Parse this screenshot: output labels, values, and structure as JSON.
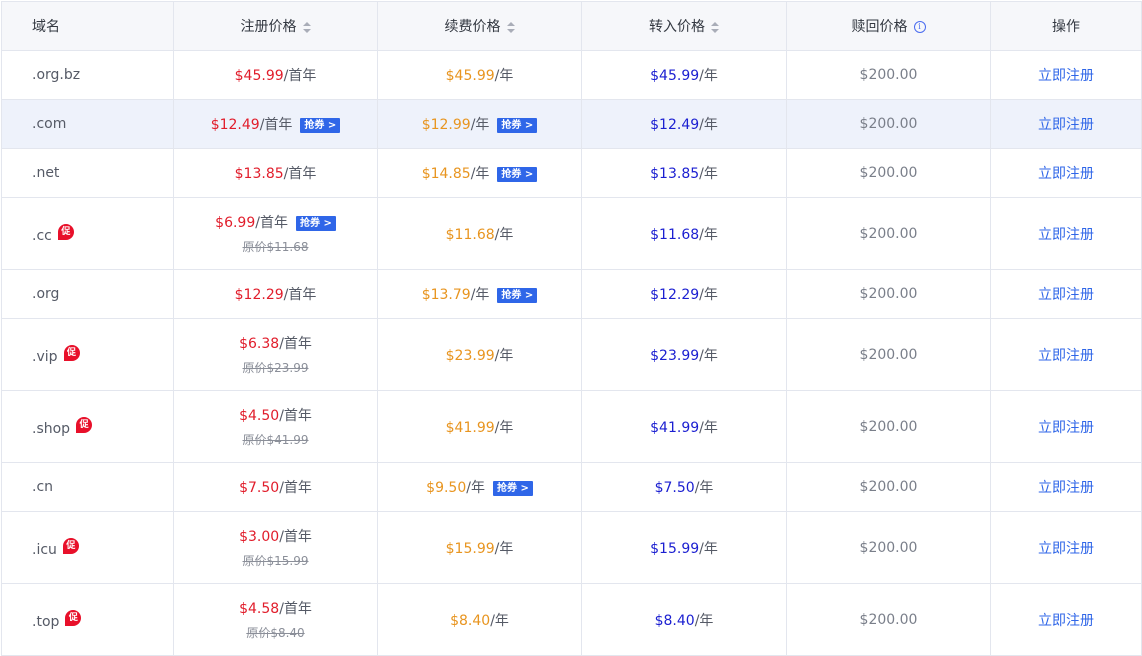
{
  "headers": {
    "domain": "域名",
    "register": "注册价格",
    "renew": "续费价格",
    "transfer": "转入价格",
    "redeem": "赎回价格",
    "action": "操作"
  },
  "icons": {
    "sort": "sort-icon",
    "info": "info-circle-icon",
    "promo": "promo-badge-icon"
  },
  "colors": {
    "register_price": "#e11d2b",
    "renew_price": "#e89520",
    "transfer_price": "#1b1fd1",
    "coupon": "#2f66e8",
    "promo_badge": "#e8102a",
    "row_highlight": "#eef2fb"
  },
  "labels": {
    "coupon": "抢券 >",
    "promo": "促",
    "action": "立即注册",
    "per_first_year": "/首年",
    "per_year": "/年",
    "original_prefix": "原价"
  },
  "rows": [
    {
      "domain": ".org.bz",
      "reg": "$45.99",
      "reg_unit": "/首年",
      "renew": "$45.99",
      "renew_unit": "/年",
      "transfer": "$45.99",
      "transfer_unit": "/年",
      "redeem": "$200.00",
      "action": "立即注册"
    },
    {
      "domain": ".com",
      "reg": "$12.49",
      "reg_unit": "/首年",
      "reg_coupon": "抢券 >",
      "renew": "$12.99",
      "renew_unit": "/年",
      "renew_coupon": "抢券 >",
      "transfer": "$12.49",
      "transfer_unit": "/年",
      "redeem": "$200.00",
      "action": "立即注册"
    },
    {
      "domain": ".net",
      "reg": "$13.85",
      "reg_unit": "/首年",
      "renew": "$14.85",
      "renew_unit": "/年",
      "renew_coupon": "抢券 >",
      "transfer": "$13.85",
      "transfer_unit": "/年",
      "redeem": "$200.00",
      "action": "立即注册"
    },
    {
      "domain": ".cc",
      "promo": "促",
      "reg": "$6.99",
      "reg_unit": "/首年",
      "reg_coupon": "抢券 >",
      "reg_original": "原价$11.68",
      "renew": "$11.68",
      "renew_unit": "/年",
      "transfer": "$11.68",
      "transfer_unit": "/年",
      "redeem": "$200.00",
      "action": "立即注册"
    },
    {
      "domain": ".org",
      "reg": "$12.29",
      "reg_unit": "/首年",
      "renew": "$13.79",
      "renew_unit": "/年",
      "renew_coupon": "抢券 >",
      "transfer": "$12.29",
      "transfer_unit": "/年",
      "redeem": "$200.00",
      "action": "立即注册"
    },
    {
      "domain": ".vip",
      "promo": "促",
      "reg": "$6.38",
      "reg_unit": "/首年",
      "reg_original": "原价$23.99",
      "renew": "$23.99",
      "renew_unit": "/年",
      "transfer": "$23.99",
      "transfer_unit": "/年",
      "redeem": "$200.00",
      "action": "立即注册"
    },
    {
      "domain": ".shop",
      "promo": "促",
      "reg": "$4.50",
      "reg_unit": "/首年",
      "reg_original": "原价$41.99",
      "renew": "$41.99",
      "renew_unit": "/年",
      "transfer": "$41.99",
      "transfer_unit": "/年",
      "redeem": "$200.00",
      "action": "立即注册"
    },
    {
      "domain": ".cn",
      "reg": "$7.50",
      "reg_unit": "/首年",
      "renew": "$9.50",
      "renew_unit": "/年",
      "renew_coupon": "抢券 >",
      "transfer": "$7.50",
      "transfer_unit": "/年",
      "redeem": "$200.00",
      "action": "立即注册"
    },
    {
      "domain": ".icu",
      "promo": "促",
      "reg": "$3.00",
      "reg_unit": "/首年",
      "reg_original": "原价$15.99",
      "renew": "$15.99",
      "renew_unit": "/年",
      "transfer": "$15.99",
      "transfer_unit": "/年",
      "redeem": "$200.00",
      "action": "立即注册"
    },
    {
      "domain": ".top",
      "promo": "促",
      "reg": "$4.58",
      "reg_unit": "/首年",
      "reg_original": "原价$8.40",
      "renew": "$8.40",
      "renew_unit": "/年",
      "transfer": "$8.40",
      "transfer_unit": "/年",
      "redeem": "$200.00",
      "action": "立即注册"
    }
  ]
}
